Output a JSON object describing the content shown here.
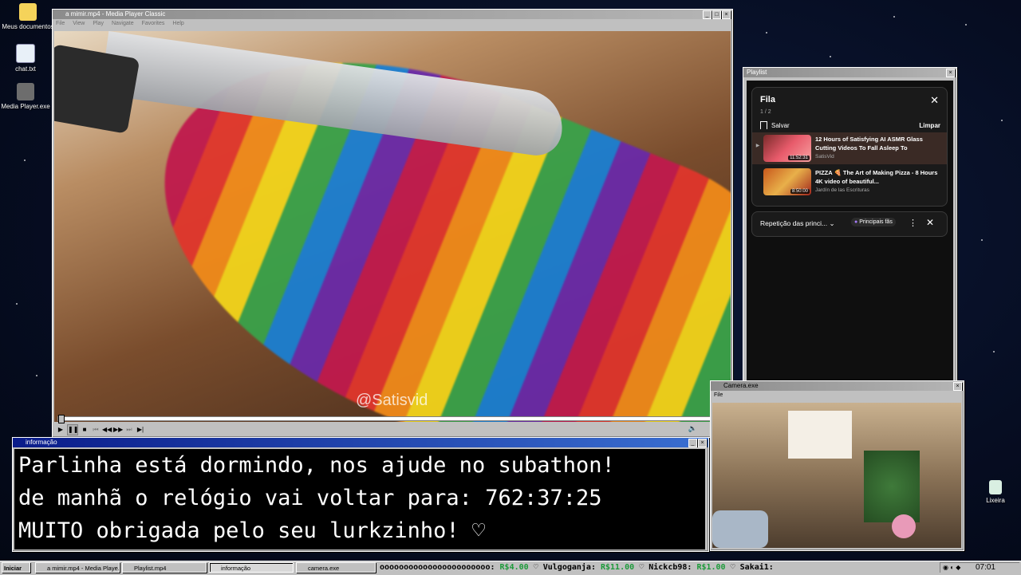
{
  "desktop": {
    "icons": [
      {
        "label": "Meus documentos",
        "icon": "folder-icon"
      },
      {
        "label": "chat.txt",
        "icon": "text-file-icon"
      },
      {
        "label": "Media Player.exe",
        "icon": "media-player-icon"
      },
      {
        "label": "Lixeira",
        "icon": "recycle-bin-icon"
      }
    ]
  },
  "media_player": {
    "title": "a mimir.mp4 - Media Player Classic",
    "menu": [
      "File",
      "View",
      "Play",
      "Navigate",
      "Favorites",
      "Help"
    ],
    "watermark": "@Satisvid",
    "progress_fraction": 0.0
  },
  "playlist": {
    "title": "Playlist",
    "queue_title": "Fila",
    "queue_count": "1 / 2",
    "save_label": "Salvar",
    "clear_label": "Limpar",
    "items": [
      {
        "title": "12 Hours of Satisfying AI ASMR Glass Cutting Videos To Fall Asleep To",
        "channel": "SatisVid",
        "duration": "11:52:31",
        "playing": true
      },
      {
        "title": "PIZZA 🍕 The Art of Making Pizza - 8 Hours 4K video of beautiful...",
        "channel": "Jardín de las Escrituras",
        "duration": "8:50:00",
        "playing": false
      }
    ],
    "repeat_label": "Repetição das princi...",
    "chip_label": "Principais fãs"
  },
  "info_window": {
    "title": "informação",
    "lines": [
      "Parlinha está dormindo, nos ajude no subathon!",
      "de manhã o relógio vai voltar para:  762:37:25",
      "MUITO obrigada pelo seu lurkzinho! ♡"
    ]
  },
  "camera": {
    "title": "Camera.exe",
    "menu": [
      "File"
    ]
  },
  "taskbar": {
    "start_label": "Iniciar",
    "tasks": [
      "a mimir.mp4 - Media Playe...",
      "Playlist.mp4",
      "informação",
      "camera.exe"
    ],
    "ticker": [
      {
        "name": "ooooooooooooooooooooooo:",
        "amount": "R$4.00"
      },
      {
        "name": "Vulgoganja:",
        "amount": "R$11.00"
      },
      {
        "name": "Nickcb98:",
        "amount": "R$1.00"
      },
      {
        "name": "Sakai1:",
        "amount": ""
      }
    ],
    "clock": "07:01"
  },
  "colors": {
    "title_active": "#0a1c8a",
    "ticker_amount": "#1d9a3a",
    "desktop_bg": "#060d22"
  }
}
